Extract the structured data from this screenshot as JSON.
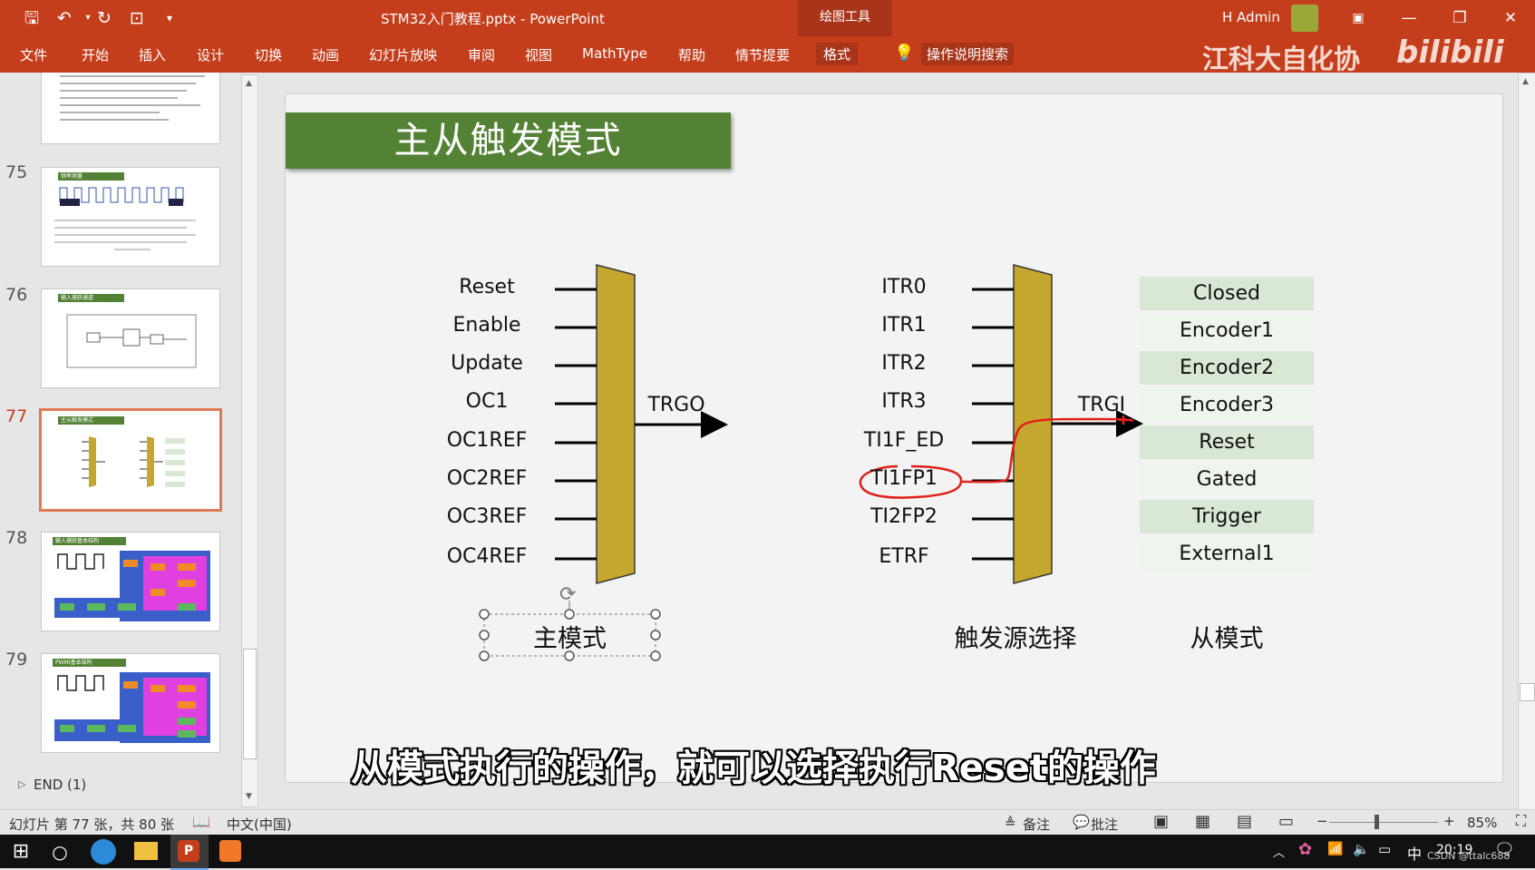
{
  "window": {
    "title": "STM32入门教程.pptx  -  PowerPoint",
    "context_tab": "绘图工具",
    "user": "H Admin",
    "watermark_text": "江科大自化协",
    "bilibili": "bilibili"
  },
  "ribbon": {
    "tabs": [
      "文件",
      "开始",
      "插入",
      "设计",
      "切换",
      "动画",
      "幻灯片放映",
      "审阅",
      "视图",
      "MathType",
      "帮助",
      "情节提要",
      "格式"
    ],
    "active_tab": "格式",
    "search_label": "操作说明搜索"
  },
  "slides_panel": {
    "numbers": [
      "75",
      "76",
      "77",
      "78",
      "79"
    ],
    "selected": "77",
    "end_section": "END (1)",
    "thumb_titles": [
      "频率测量",
      "输入捕获通道",
      "主从触发模式",
      "输入捕获基本结构",
      "PWMI基本结构"
    ]
  },
  "slide": {
    "title": "主从触发模式",
    "master_inputs": [
      "Reset",
      "Enable",
      "Update",
      "OC1",
      "OC1REF",
      "OC2REF",
      "OC3REF",
      "OC4REF"
    ],
    "master_output": "TRGO",
    "master_caption": "主模式",
    "trigger_inputs": [
      "ITR0",
      "ITR1",
      "ITR2",
      "ITR3",
      "TI1F_ED",
      "TI1FP1",
      "TI2FP2",
      "ETRF"
    ],
    "trigger_output": "TRGI",
    "trigger_caption": "触发源选择",
    "slave_modes": [
      "Closed",
      "Encoder1",
      "Encoder2",
      "Encoder3",
      "Reset",
      "Gated",
      "Trigger",
      "External1"
    ],
    "slave_caption": "从模式"
  },
  "subtitle": "从模式执行的操作，就可以选择执行Reset的操作",
  "status": {
    "slide_info": "幻灯片 第 77 张，共 80 张",
    "language": "中文(中国)",
    "notes": "备注",
    "comments": "批注",
    "zoom": "85%"
  },
  "taskbar": {
    "time": "20:19",
    "ime": "中",
    "csdn": "CSDN @ttalc688"
  },
  "colors": {
    "ribbon": "#c43e1c",
    "title_bg": "#548235",
    "mux_fill": "#c5a62e",
    "slave_dark": "#d9e8d4",
    "slave_light": "#eef5ec",
    "annotation": "#e0201a"
  }
}
